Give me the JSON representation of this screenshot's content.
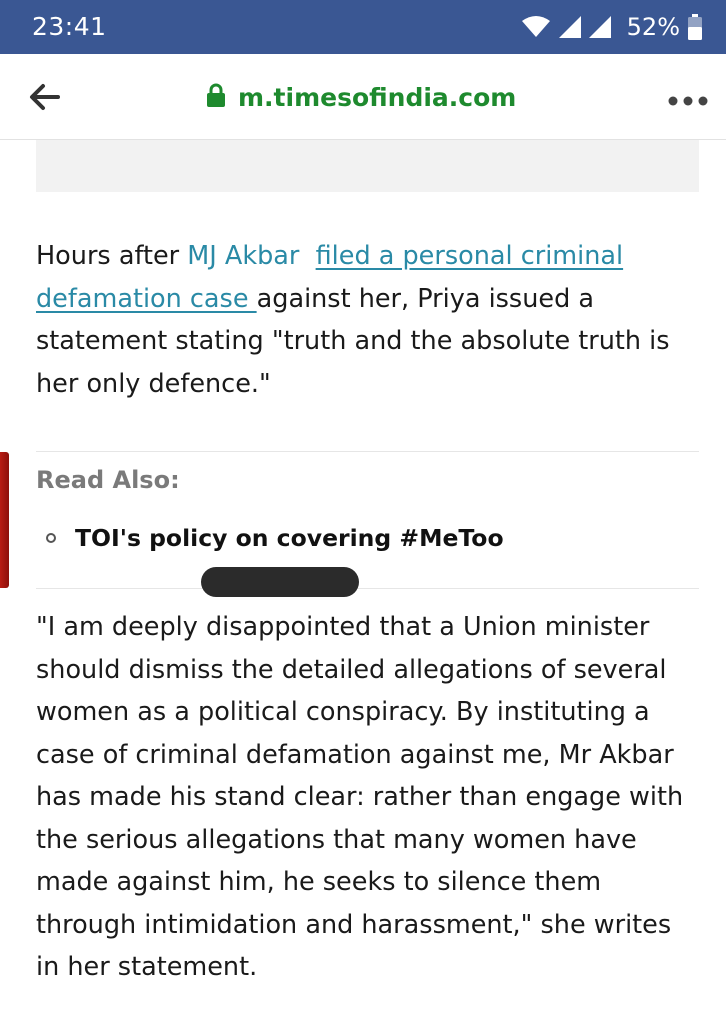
{
  "status_bar": {
    "time": "23:41",
    "battery_percent": "52%",
    "icons": [
      "wifi-icon",
      "signal-icon",
      "signal-icon",
      "battery-icon"
    ]
  },
  "browser": {
    "url": "m.timesofindia.com",
    "url_color": "#1e8a2e",
    "icons": [
      "back-arrow-icon",
      "lock-icon",
      "more-options-icon"
    ]
  },
  "article": {
    "para1": {
      "prefix": "Hours after ",
      "link1": "MJ Akbar",
      "gap": "  ",
      "link2": "filed a personal criminal defamation case ",
      "suffix": "against her, Priya issued a statement stating \"truth and the absolute truth is her only defence.\""
    },
    "read_also": {
      "heading": "Read Also:",
      "items": [
        "TOI's policy on covering #MeToo"
      ]
    },
    "para2": "\"I am deeply disappointed that a Union minister should dismiss the detailed allegations of several women as a political conspiracy. By instituting a case of criminal defamation against me, Mr Akbar has made his stand clear: rather than engage with the serious allegations that many women have made against him, he seeks to silence them through intimidation and harassment,\" she writes in her statement."
  },
  "colors": {
    "status_bar_bg": "#3a5793",
    "link": "#2a8aa6",
    "accent_bar": "#b81c14"
  }
}
